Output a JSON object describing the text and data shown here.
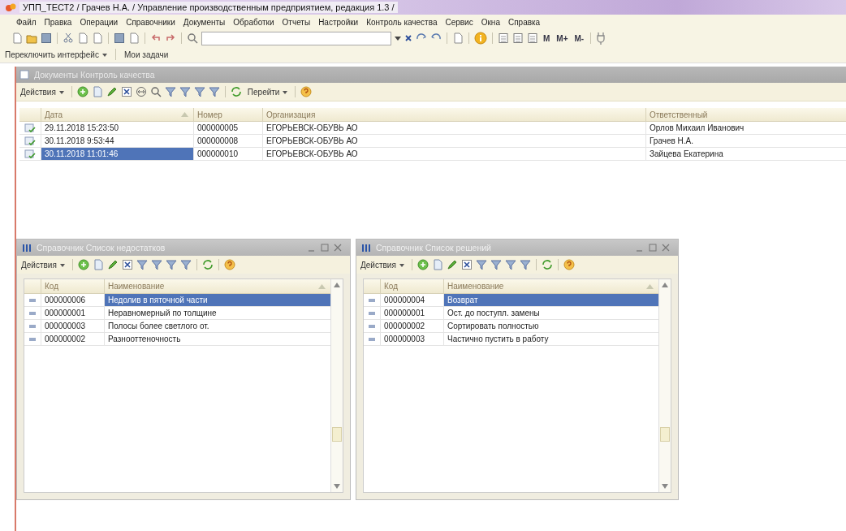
{
  "window": {
    "title": "УПП_ТЕСТ2 / Грачев Н.А. / Управление производственным предприятием, редакция 1.3 /"
  },
  "menu": [
    "Файл",
    "Правка",
    "Операции",
    "Справочники",
    "Документы",
    "Обработки",
    "Отчеты",
    "Настройки",
    "Контроль качества",
    "Сервис",
    "Окна",
    "Справка"
  ],
  "toolbar": {
    "memory_buttons": [
      "M",
      "M+",
      "M-"
    ]
  },
  "panel": {
    "switch_interface": "Переключить интерфейс",
    "my_tasks": "Мои задачи"
  },
  "documents": {
    "title": "Документы Контроль качества",
    "actions": "Действия",
    "goto": "Перейти",
    "columns": [
      "Дата",
      "Номер",
      "Организация",
      "Ответственный"
    ],
    "rows": [
      {
        "cells": [
          "29.11.2018 15:23:50",
          "000000005",
          "ЕГОРЬЕВСК-ОБУВЬ АО",
          "Орлов Михаил Иванович"
        ],
        "selected": false
      },
      {
        "cells": [
          "30.11.2018 9:53:44",
          "000000008",
          "ЕГОРЬЕВСК-ОБУВЬ АО",
          "Грачев Н.А."
        ],
        "selected": false
      },
      {
        "cells": [
          "30.11.2018 11:01:46",
          "000000010",
          "ЕГОРЬЕВСК-ОБУВЬ АО",
          "Зайцева Екатерина"
        ],
        "selected": true
      }
    ]
  },
  "subwindows": [
    {
      "title": "Справочник Список недостатков",
      "actions": "Действия",
      "columns": [
        "Код",
        "Наименование"
      ],
      "rows": [
        {
          "cells": [
            "000000006",
            "Недолив в пяточной части"
          ],
          "selected": true
        },
        {
          "cells": [
            "000000001",
            "Неравномерный по толщине"
          ],
          "selected": false
        },
        {
          "cells": [
            "000000003",
            "Полосы более светлого от."
          ],
          "selected": false
        },
        {
          "cells": [
            "000000002",
            "Разнооттеночность"
          ],
          "selected": false
        }
      ]
    },
    {
      "title": "Справочник Список решений",
      "actions": "Действия",
      "columns": [
        "Код",
        "Наименование"
      ],
      "rows": [
        {
          "cells": [
            "000000004",
            "Возврат"
          ],
          "selected": true
        },
        {
          "cells": [
            "000000001",
            "Ост. до поступл. замены"
          ],
          "selected": false
        },
        {
          "cells": [
            "000000002",
            "Сортировать полностью"
          ],
          "selected": false
        },
        {
          "cells": [
            "000000003",
            "Частично пустить в работу"
          ],
          "selected": false
        }
      ]
    }
  ]
}
